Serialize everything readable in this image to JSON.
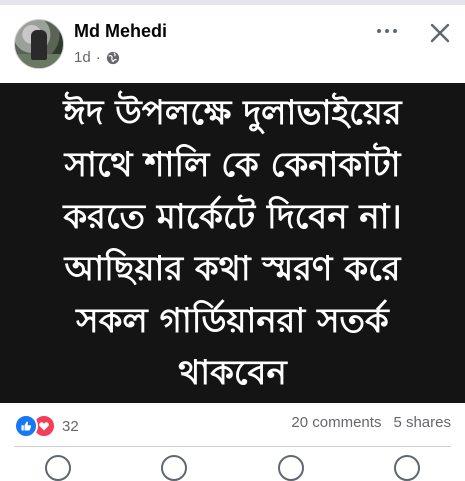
{
  "post": {
    "author": "Md Mehedi",
    "time": "1d",
    "separator": "·",
    "audience_icon": "globe-icon",
    "text": "ঈদ উপলক্ষে দুলাভাইয়ের\nসাথে শালি কে কেনাকাটা\nকরতে মার্কেটে দিবেন না।\nআছিয়ার কথা স্মরণ করে\nসকল গার্ডিয়ানরা সতর্ক\nথাকবেন"
  },
  "header": {
    "more_icon": "more-options-icon",
    "close_icon": "close-icon"
  },
  "stats": {
    "reaction_icons": [
      "like-icon",
      "love-icon"
    ],
    "reaction_count": "32",
    "comments": "20 comments",
    "shares": "5 shares"
  },
  "colors": {
    "post_background": "#141414",
    "post_text": "#ffffff",
    "like": "#1877f2",
    "love": "#f33e58",
    "secondary_text": "#65676b"
  }
}
